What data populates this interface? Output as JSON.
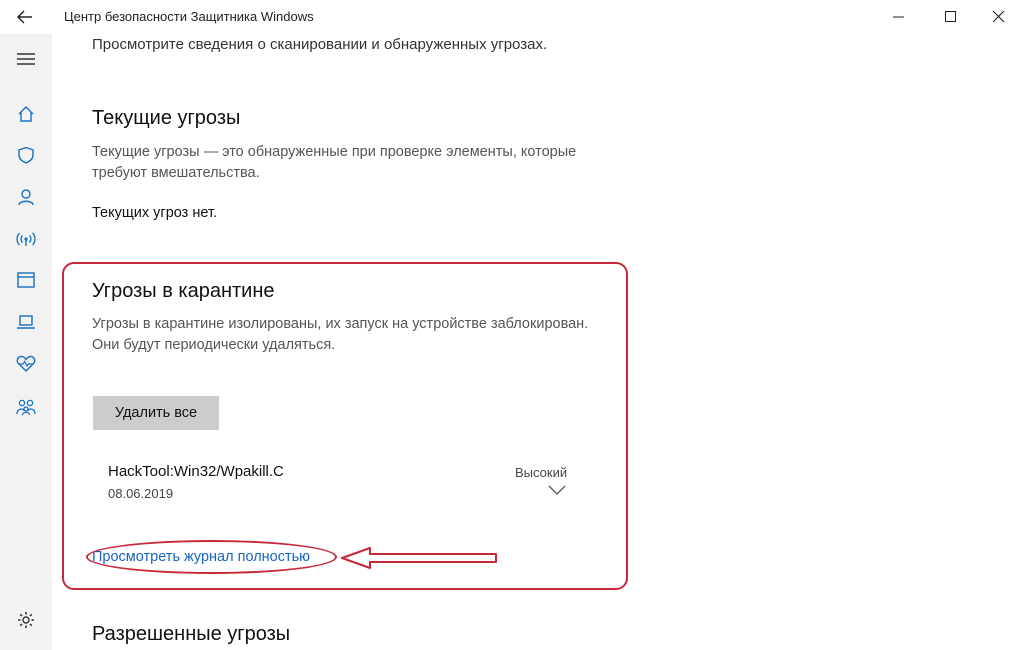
{
  "window": {
    "title": "Центр безопасности Защитника Windows"
  },
  "icons": {
    "back": "arrow-left-icon",
    "menu": "hamburger-menu-icon",
    "home": "home-icon",
    "virus": "shield-icon",
    "account": "person-icon",
    "firewall": "wifi-antenna-icon",
    "app_browser": "window-icon",
    "device": "laptop-icon",
    "health": "heart-pulse-icon",
    "family": "family-icon",
    "settings": "gear-icon"
  },
  "content": {
    "intro": "Просмотрите сведения о сканировании и обнаруженных угрозах.",
    "current": {
      "heading": "Текущие угрозы",
      "description": "Текущие угрозы — это обнаруженные при проверке элементы, которые требуют вмешательства.",
      "status": "Текущих угроз нет."
    },
    "quarantine": {
      "heading": "Угрозы в карантине",
      "description": "Угрозы в карантине изолированы, их запуск на устройстве заблокирован. Они будут периодически удаляться.",
      "delete_all_label": "Удалить все",
      "items": [
        {
          "name": "HackTool:Win32/Wpakill.C",
          "date": "08.06.2019",
          "severity": "Высокий"
        }
      ],
      "full_log_link": "Просмотреть журнал полностью"
    },
    "allowed": {
      "heading": "Разрешенные угрозы"
    }
  },
  "colors": {
    "accent_link": "#1565c0",
    "annotation": "#c8283a",
    "sidebar_bg": "#f2f2f2",
    "button_bg": "#cccccc"
  }
}
